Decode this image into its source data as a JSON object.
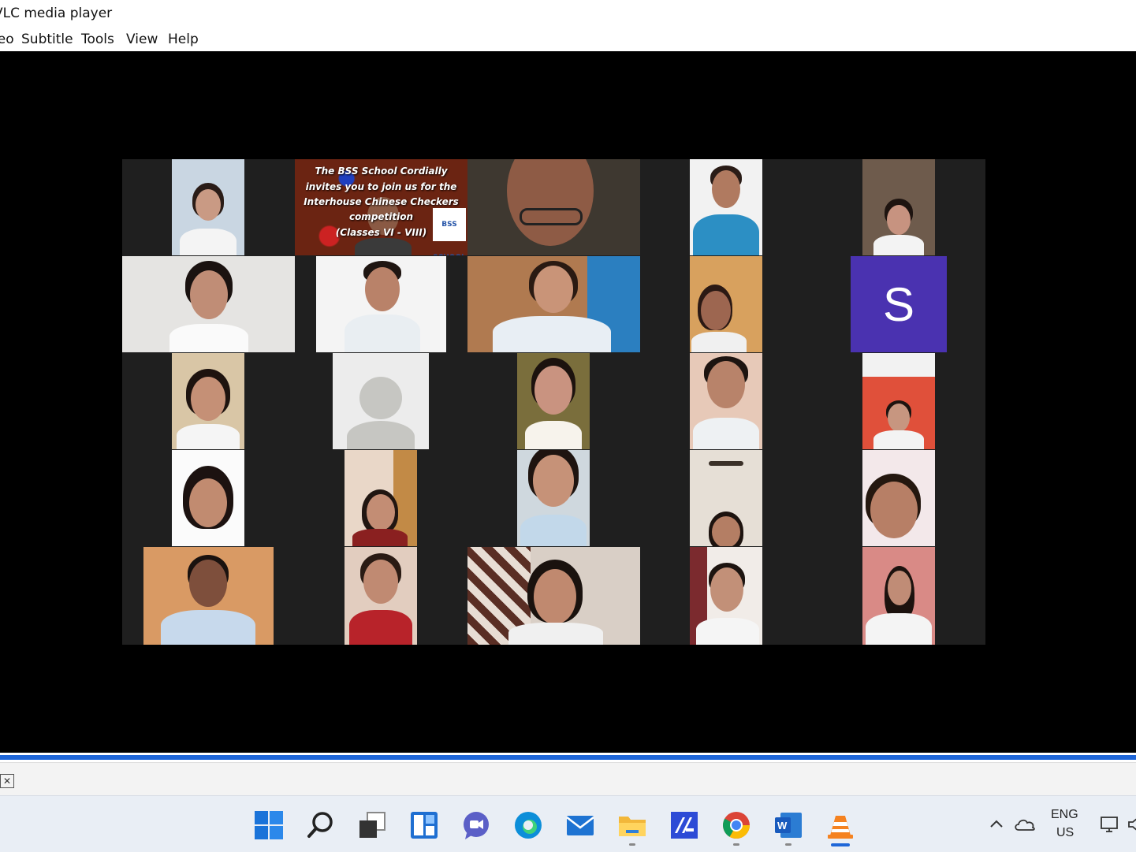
{
  "window": {
    "title": "VLC media player"
  },
  "menu": {
    "items": [
      "Video",
      "Subtitle",
      "Tools",
      "View",
      "Help"
    ]
  },
  "meeting": {
    "banner_lines": [
      "The BSS School Cordially",
      "invites you to join us for the",
      "Interhouse Chinese Checkers",
      "competition",
      "(Classes VI - VIII)"
    ],
    "banner_logo": "BSS SCHOOL",
    "avatar_initial": "S",
    "avatar_color": "#4a32b0"
  },
  "playback": {
    "progress_percent": 100
  },
  "taskbar": {
    "apps": [
      "start",
      "search",
      "task-view",
      "widgets",
      "chat",
      "edge",
      "mail",
      "file-explorer",
      "zoom-meetings",
      "chrome",
      "word",
      "vlc"
    ],
    "language_top": "ENG",
    "language_bottom": "US"
  }
}
